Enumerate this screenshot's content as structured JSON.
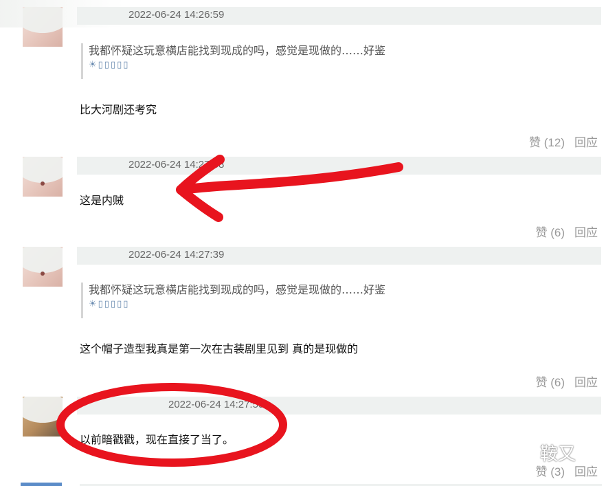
{
  "comments": [
    {
      "time": "2022-06-24 14:26:59",
      "quote": "我都怀疑这玩意横店能找到现成的吗，感觉是现做的……好鉴",
      "quote_sub": "☀▯▯▯▯▯",
      "text": "比大河剧还考究",
      "like": "赞 (12)",
      "reply": "回应"
    },
    {
      "time": "2022-06-24 14:27:38",
      "text": "这是内贼",
      "like": "赞 (6)",
      "reply": "回应"
    },
    {
      "time": "2022-06-24 14:27:39",
      "quote": "我都怀疑这玩意横店能找到现成的吗，感觉是现做的……好鉴",
      "quote_sub": "☀▯▯▯▯▯",
      "text": "这个帽子造型我真是第一次在古装剧里见到 真的是现做的",
      "like": "赞 (6)",
      "reply": "回应"
    },
    {
      "time": "2022-06-24 14:27:59",
      "text": "以前暗戳戳，现在直接了当了。",
      "like": "赞 (3)",
      "reply": "回应"
    }
  ],
  "watermark": "鞍又",
  "annotation_color": "#e8141e"
}
